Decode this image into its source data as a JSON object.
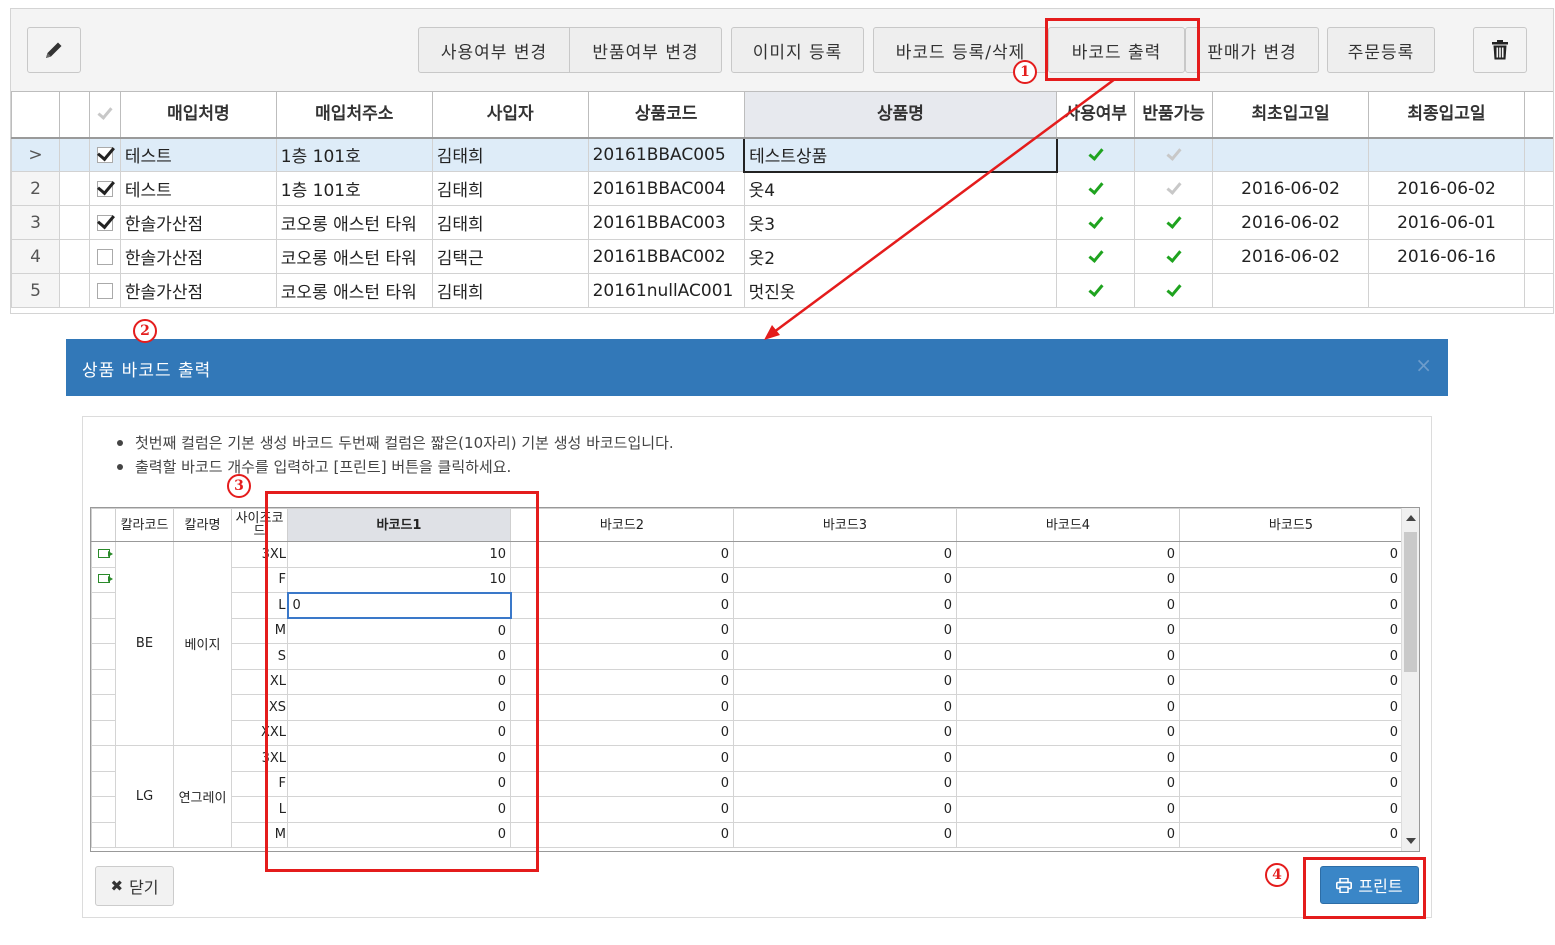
{
  "toolbar": {
    "edit_icon": "pencil-icon",
    "use_change": "사용여부 변경",
    "return_change": "반품여부 변경",
    "image_register": "이미지 등록",
    "barcode_register": "바코드 등록/삭제",
    "barcode_print": "바코드 출력",
    "price_change": "판매가 변경",
    "order_register": "주문등록",
    "delete_icon": "trash-icon"
  },
  "grid": {
    "headers": [
      "매입처명",
      "매입처주소",
      "사입자",
      "상품코드",
      "상품명",
      "사용여부",
      "반품가능",
      "최초입고일",
      "최종입고일"
    ],
    "rows": [
      {
        "no": ">",
        "checked": true,
        "vendor": "테스트",
        "address": "1층 101호",
        "buyer": "김태희",
        "code": "20161BBAC005",
        "name": "테스트상품",
        "use": true,
        "ret": false,
        "first": "",
        "last": ""
      },
      {
        "no": "2",
        "checked": true,
        "vendor": "테스트",
        "address": "1층 101호",
        "buyer": "김태희",
        "code": "20161BBAC004",
        "name": "옷4",
        "use": true,
        "ret": false,
        "first": "2016-06-02",
        "last": "2016-06-02"
      },
      {
        "no": "3",
        "checked": true,
        "vendor": "한솔가산점",
        "address": "코오롱 애스턴 타워",
        "buyer": "김태희",
        "code": "20161BBAC003",
        "name": "옷3",
        "use": true,
        "ret": true,
        "first": "2016-06-02",
        "last": "2016-06-01"
      },
      {
        "no": "4",
        "checked": false,
        "vendor": "한솔가산점",
        "address": "코오롱 애스턴 타워",
        "buyer": "김택근",
        "code": "20161BBAC002",
        "name": "옷2",
        "use": true,
        "ret": true,
        "first": "2016-06-02",
        "last": "2016-06-16"
      },
      {
        "no": "5",
        "checked": false,
        "vendor": "한솔가산점",
        "address": "코오롱 애스턴 타워",
        "buyer": "김태희",
        "code": "20161nullAC001",
        "name": "멋진옷",
        "use": true,
        "ret": true,
        "first": "",
        "last": ""
      }
    ]
  },
  "modal": {
    "title": "상품 바코드 출력",
    "close_icon": "×",
    "notes": [
      "첫번째 컬럼은 기본 생성 바코드 두번째 컬럼은 짧은(10자리) 기본 생성 바코드입니다.",
      "출력할 바코드 개수를 입력하고 [프린트] 버튼을 클릭하세요."
    ],
    "headers": [
      "칼라코드",
      "칼라명",
      "사이즈코드",
      "바코드1",
      "바코드2",
      "바코드3",
      "바코드4",
      "바코드5"
    ],
    "groups": [
      {
        "code": "BE",
        "name": "베이지",
        "sizes": [
          "3XL",
          "F",
          "L",
          "M",
          "S",
          "XL",
          "XS",
          "XXL"
        ]
      },
      {
        "code": "LG",
        "name": "연그레이",
        "sizes": [
          "3XL",
          "F",
          "L",
          "M"
        ]
      }
    ],
    "values": [
      [
        "10",
        "0",
        "0",
        "0",
        "0"
      ],
      [
        "10",
        "0",
        "0",
        "0",
        "0"
      ],
      [
        "0",
        "0",
        "0",
        "0",
        "0"
      ],
      [
        "0",
        "0",
        "0",
        "0",
        "0"
      ],
      [
        "0",
        "0",
        "0",
        "0",
        "0"
      ],
      [
        "0",
        "0",
        "0",
        "0",
        "0"
      ],
      [
        "0",
        "0",
        "0",
        "0",
        "0"
      ],
      [
        "0",
        "0",
        "0",
        "0",
        "0"
      ],
      [
        "0",
        "0",
        "0",
        "0",
        "0"
      ],
      [
        "0",
        "0",
        "0",
        "0",
        "0"
      ],
      [
        "0",
        "0",
        "0",
        "0",
        "0"
      ],
      [
        "0",
        "0",
        "0",
        "0",
        "0"
      ]
    ],
    "close_label": "닫기",
    "print_label": "프린트"
  },
  "annotations": {
    "m1": "1",
    "m2": "2",
    "m3": "3",
    "m4": "4",
    "color": "#e41c1c"
  }
}
